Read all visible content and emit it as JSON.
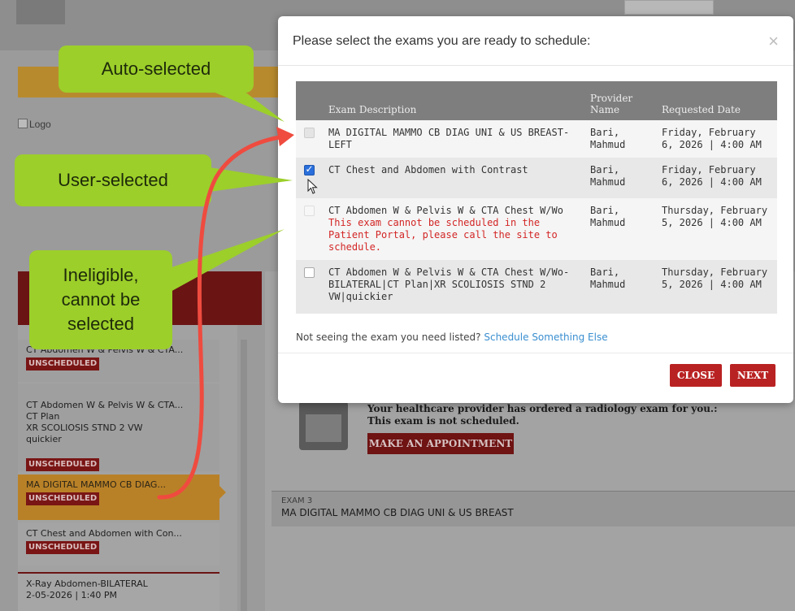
{
  "background": {
    "logo_alt": "Logo",
    "sidebar_cards": [
      {
        "title": "CT Abdomen W & Pelvis W & CTA...",
        "badge": "UNSCHEDULED"
      },
      {
        "title": "CT Abdomen W & Pelvis W & CTA...\nCT Plan\nXR SCOLIOSIS STND 2 VW\nquickier",
        "badge": "UNSCHEDULED"
      },
      {
        "title": "MA DIGITAL MAMMO CB DIAG...",
        "badge": "UNSCHEDULED"
      },
      {
        "title": "CT Chest and Abdomen with Con...",
        "badge": "UNSCHEDULED"
      },
      {
        "title": "X-Ray Abdomen-BILATERAL",
        "date": "2-05-2026 | 1:40 PM"
      }
    ],
    "ordered_text": "Your healthcare provider has ordered a radiology exam for you.:",
    "not_scheduled_text": "This exam is not scheduled.",
    "make_appointment": "MAKE AN APPOINTMENT",
    "exam3_label": "EXAM 3",
    "exam3_text": "MA DIGITAL MAMMO CB DIAG UNI & US BREAST"
  },
  "modal": {
    "title": "Please select the exams you are ready to schedule:",
    "close_glyph": "×",
    "columns": {
      "description": "Exam Description",
      "provider": "Provider Name",
      "date": "Requested Date"
    },
    "rows": [
      {
        "description": "MA DIGITAL MAMMO CB DIAG UNI & US BREAST-LEFT",
        "warning": "",
        "provider": "Bari, Mahmud",
        "date": "Friday, February 6, 2026 | 4:00 AM",
        "state": "auto-selected"
      },
      {
        "description": "CT Chest and Abdomen with Contrast",
        "warning": "",
        "provider": "Bari, Mahmud",
        "date": "Friday, February 6, 2026 | 4:00 AM",
        "state": "checked"
      },
      {
        "description": "CT Abdomen W & Pelvis W & CTA Chest W/Wo",
        "warning": "This exam cannot be scheduled in the Patient Portal, please call the site to schedule.",
        "provider": "Bari, Mahmud",
        "date": "Thursday, February 5, 2026 | 4:00 AM",
        "state": "ineligible"
      },
      {
        "description": "CT Abdomen W & Pelvis W & CTA Chest W/Wo-BILATERAL|CT Plan|XR SCOLIOSIS STND 2 VW|quickier",
        "warning": "",
        "provider": "Bari, Mahmud",
        "date": "Thursday, February 5, 2026 | 4:00 AM",
        "state": "unchecked"
      }
    ],
    "not_seeing_text": "Not seeing the exam you need listed?",
    "schedule_link": "Schedule Something Else",
    "close_button": "CLOSE",
    "next_button": "NEXT"
  },
  "callouts": {
    "auto": "Auto-selected",
    "user": "User-selected",
    "ineligible_1": "Ineligible,",
    "ineligible_2": "cannot be",
    "ineligible_3": "selected"
  },
  "colors": {
    "callout_green": "#9ccf2a",
    "button_red": "#b92222",
    "arrow_red": "#ef4b3f",
    "link_blue": "#3a8fd0",
    "warning_red": "#d32626"
  },
  "icons": {
    "close": "close-icon",
    "calendar": "calendar-icon",
    "cursor": "cursor-icon",
    "arrow": "curved-arrow"
  }
}
